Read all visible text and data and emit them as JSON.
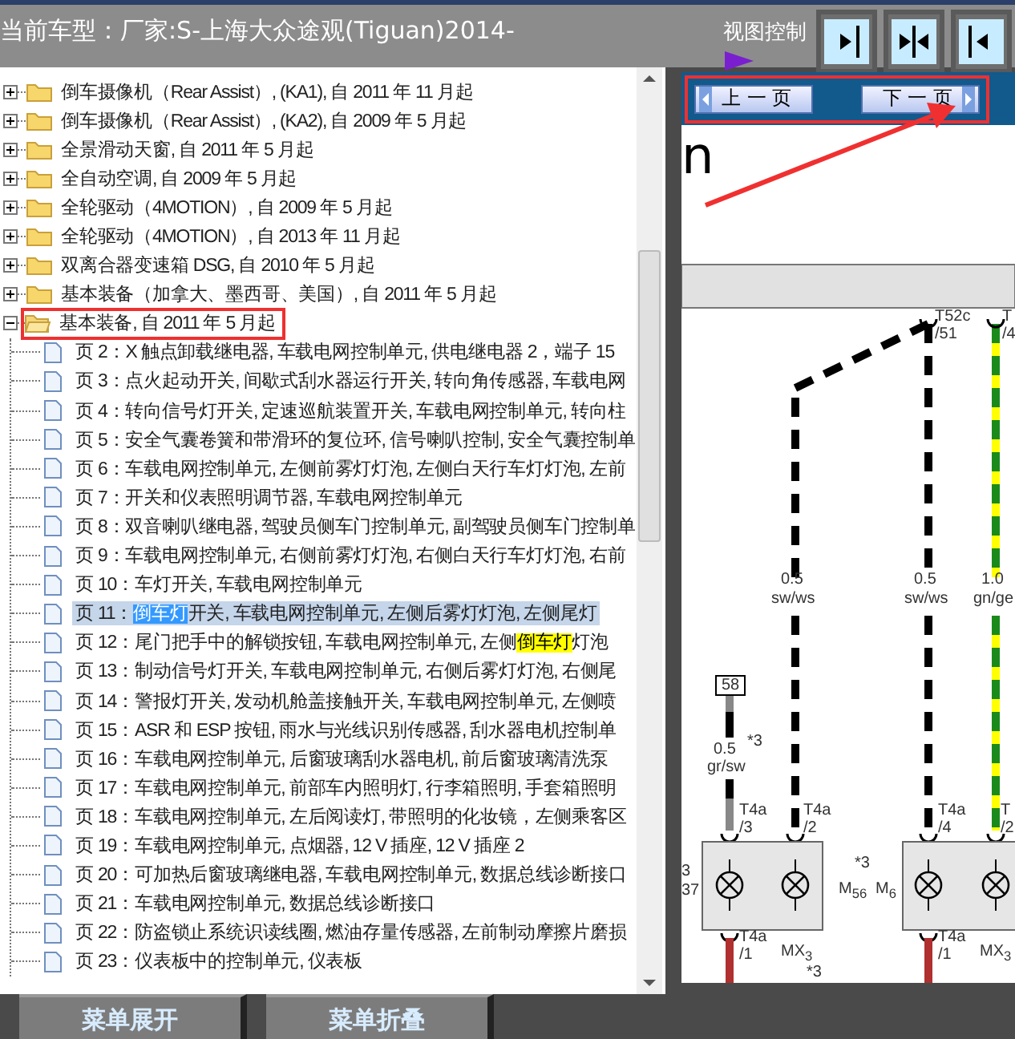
{
  "header": {
    "title": "当前车型：厂家:S-上海大众途观(Tiguan)2014-",
    "view_control_label": "视图控制"
  },
  "tree": {
    "items": [
      {
        "kind": "folder",
        "label": "倒车摄像机（Rear Assist）, (KA1), 自 2011 年 11 月起",
        "expanded": false,
        "annotated": false
      },
      {
        "kind": "folder",
        "label": "倒车摄像机（Rear Assist）, (KA2), 自 2009 年 5 月起",
        "expanded": false,
        "annotated": false
      },
      {
        "kind": "folder",
        "label": "全景滑动天窗, 自 2011 年 5 月起",
        "expanded": false,
        "annotated": false
      },
      {
        "kind": "folder",
        "label": "全自动空调, 自 2009 年 5 月起",
        "expanded": false,
        "annotated": false
      },
      {
        "kind": "folder",
        "label": "全轮驱动（4MOTION）, 自 2009 年 5 月起",
        "expanded": false,
        "annotated": false
      },
      {
        "kind": "folder",
        "label": "全轮驱动（4MOTION）, 自 2013 年 11 月起",
        "expanded": false,
        "annotated": false
      },
      {
        "kind": "folder",
        "label": "双离合器变速箱 DSG, 自 2010 年 5 月起",
        "expanded": false,
        "annotated": false
      },
      {
        "kind": "folder",
        "label": "基本装备（加拿大、墨西哥、美国）, 自 2011 年 5 月起",
        "expanded": false,
        "annotated": false
      },
      {
        "kind": "folder",
        "label": "基本装备, 自 2011 年 5 月起",
        "expanded": true,
        "annotated": true,
        "children": [
          {
            "kind": "page",
            "selected": false,
            "segments": [
              {
                "text": "页 2：X 触点卸载继电器, 车载电网控制单元, 供电继电器 2，端子 15"
              }
            ]
          },
          {
            "kind": "page",
            "selected": false,
            "segments": [
              {
                "text": "页 3：点火起动开关, 间歇式刮水器运行开关, 转向角传感器, 车载电网"
              }
            ]
          },
          {
            "kind": "page",
            "selected": false,
            "segments": [
              {
                "text": "页 4：转向信号灯开关, 定速巡航装置开关, 车载电网控制单元, 转向柱"
              }
            ]
          },
          {
            "kind": "page",
            "selected": false,
            "segments": [
              {
                "text": "页 5：安全气囊卷簧和带滑环的复位环, 信号喇叭控制, 安全气囊控制单"
              }
            ]
          },
          {
            "kind": "page",
            "selected": false,
            "segments": [
              {
                "text": "页 6：车载电网控制单元, 左侧前雾灯灯泡, 左侧白天行车灯灯泡, 左前"
              }
            ]
          },
          {
            "kind": "page",
            "selected": false,
            "segments": [
              {
                "text": "页 7：开关和仪表照明调节器, 车载电网控制单元"
              }
            ]
          },
          {
            "kind": "page",
            "selected": false,
            "segments": [
              {
                "text": "页 8：双音喇叭继电器, 驾驶员侧车门控制单元, 副驾驶员侧车门控制单"
              }
            ]
          },
          {
            "kind": "page",
            "selected": false,
            "segments": [
              {
                "text": "页 9：车载电网控制单元, 右侧前雾灯灯泡, 右侧白天行车灯灯泡, 右前"
              }
            ]
          },
          {
            "kind": "page",
            "selected": false,
            "segments": [
              {
                "text": "页 10：车灯开关, 车载电网控制单元"
              }
            ]
          },
          {
            "kind": "page",
            "selected": true,
            "segments": [
              {
                "text": "页 11：",
                "selected": false,
                "matched": false
              },
              {
                "text": "倒车灯",
                "selected": true,
                "matched": false
              },
              {
                "text": "开关, 车载电网控制单元, 左侧后雾灯灯泡, 左侧尾灯",
                "selected": false,
                "matched": false
              }
            ]
          },
          {
            "kind": "page",
            "selected": false,
            "segments": [
              {
                "text": "页 12：尾门把手中的解锁按钮, 车载电网控制单元, 左侧",
                "selected": false,
                "matched": false
              },
              {
                "text": "倒车灯",
                "selected": false,
                "matched": true
              },
              {
                "text": "灯泡",
                "selected": false,
                "matched": false
              }
            ]
          },
          {
            "kind": "page",
            "selected": false,
            "segments": [
              {
                "text": "页 13：制动信号灯开关, 车载电网控制单元, 右侧后雾灯灯泡, 右侧尾"
              }
            ]
          },
          {
            "kind": "page",
            "selected": false,
            "segments": [
              {
                "text": "页 14：警报灯开关, 发动机舱盖接触开关, 车载电网控制单元, 左侧喷"
              }
            ]
          },
          {
            "kind": "page",
            "selected": false,
            "segments": [
              {
                "text": "页 15：ASR 和 ESP 按钮, 雨水与光线识别传感器, 刮水器电机控制单"
              }
            ]
          },
          {
            "kind": "page",
            "selected": false,
            "segments": [
              {
                "text": "页 16：车载电网控制单元, 后窗玻璃刮水器电机, 前后窗玻璃清洗泵"
              }
            ]
          },
          {
            "kind": "page",
            "selected": false,
            "segments": [
              {
                "text": "页 17：车载电网控制单元, 前部车内照明灯, 行李箱照明, 手套箱照明"
              }
            ]
          },
          {
            "kind": "page",
            "selected": false,
            "segments": [
              {
                "text": "页 18：车载电网控制单元, 左后阅读灯, 带照明的化妆镜，左侧乘客区"
              }
            ]
          },
          {
            "kind": "page",
            "selected": false,
            "segments": [
              {
                "text": "页 19：车载电网控制单元, 点烟器, 12 V 插座, 12 V 插座 2"
              }
            ]
          },
          {
            "kind": "page",
            "selected": false,
            "segments": [
              {
                "text": "页 20：可加热后窗玻璃继电器, 车载电网控制单元, 数据总线诊断接口"
              }
            ]
          },
          {
            "kind": "page",
            "selected": false,
            "segments": [
              {
                "text": "页 21：车载电网控制单元, 数据总线诊断接口"
              }
            ]
          },
          {
            "kind": "page",
            "selected": false,
            "segments": [
              {
                "text": "页 22：防盗锁止系统识读线圈, 燃油存量传感器, 左前制动摩擦片磨损"
              }
            ]
          },
          {
            "kind": "page",
            "selected": false,
            "segments": [
              {
                "text": "页 23：仪表板中的控制单元, 仪表板"
              }
            ]
          }
        ]
      }
    ]
  },
  "nav": {
    "prev": "上 一 页",
    "next": "下 一 页",
    "annotated": true
  },
  "diagram": {
    "heading": "n",
    "labels": [
      {
        "kind": "text",
        "text": "0.5"
      },
      {
        "kind": "text",
        "text": "sw/ws"
      },
      {
        "kind": "text",
        "text": "0.5"
      },
      {
        "kind": "text",
        "text": "sw/ws"
      },
      {
        "kind": "text",
        "text": "1.0"
      },
      {
        "kind": "text",
        "text": "gn/ge"
      },
      {
        "kind": "text",
        "text": "T52c"
      },
      {
        "kind": "text",
        "text": "/51"
      },
      {
        "kind": "text",
        "text": "T"
      },
      {
        "kind": "text",
        "text": "/4"
      },
      {
        "kind": "boxed",
        "text": "58"
      },
      {
        "kind": "text",
        "text": "0.5"
      },
      {
        "kind": "text",
        "text": "*3"
      },
      {
        "kind": "text",
        "text": "gr/sw"
      },
      {
        "kind": "text",
        "text": "T4a"
      },
      {
        "kind": "text",
        "text": "/3"
      },
      {
        "kind": "text",
        "text": "T4a"
      },
      {
        "kind": "text",
        "text": "/2"
      },
      {
        "kind": "text",
        "text": "T4a"
      },
      {
        "kind": "text",
        "text": "/4"
      },
      {
        "kind": "text",
        "text": "T"
      },
      {
        "kind": "text",
        "text": "/2"
      },
      {
        "kind": "text",
        "text": "3"
      },
      {
        "kind": "text",
        "text": "37"
      },
      {
        "kind": "text",
        "text": "*3"
      },
      {
        "kind": "text",
        "text": "M$_{56}$"
      },
      {
        "kind": "text",
        "text": "M$_{6}$"
      },
      {
        "kind": "text",
        "text": "T4a"
      },
      {
        "kind": "text",
        "text": "/1"
      },
      {
        "kind": "text",
        "text": "MX$_{3}$"
      },
      {
        "kind": "text",
        "text": "*3"
      },
      {
        "kind": "text",
        "text": "T4a"
      },
      {
        "kind": "text",
        "text": "/1"
      },
      {
        "kind": "text",
        "text": "MX$_{3}$"
      }
    ]
  },
  "footer_buttons": [
    "菜单展开",
    "菜单折叠"
  ]
}
